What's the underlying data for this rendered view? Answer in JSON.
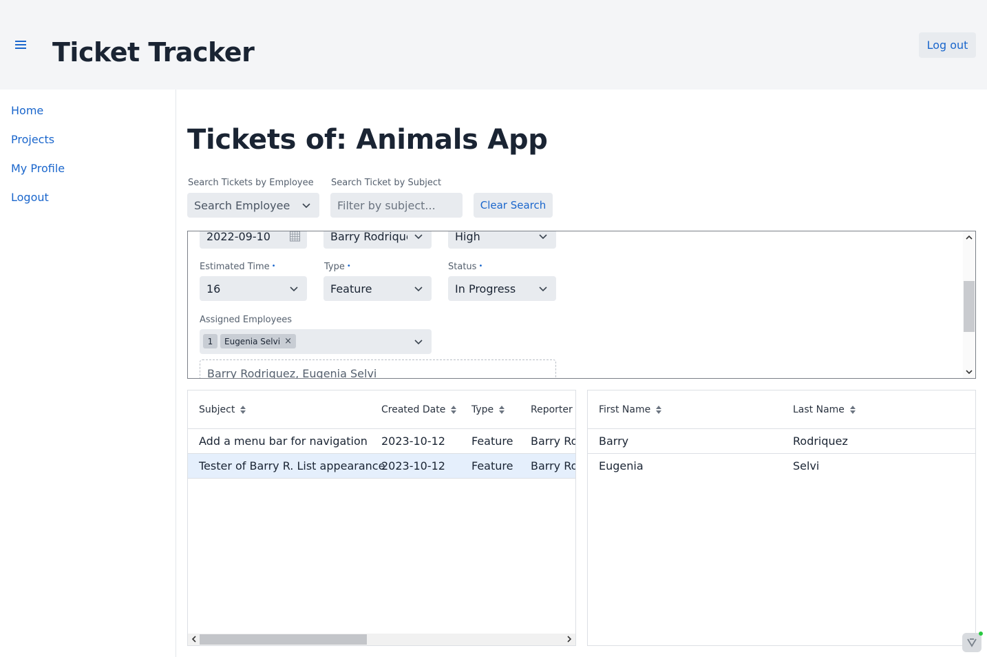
{
  "header": {
    "title": "Ticket Tracker",
    "logout_label": "Log out"
  },
  "sidebar": {
    "items": [
      {
        "label": "Home"
      },
      {
        "label": "Projects"
      },
      {
        "label": "My Profile"
      },
      {
        "label": "Logout"
      }
    ]
  },
  "page": {
    "title": "Tickets of: Animals App"
  },
  "search": {
    "employee_label": "Search Tickets by Employee",
    "employee_placeholder": "Search Employee",
    "subject_label": "Search Ticket by Subject",
    "subject_placeholder": "Filter by subject...",
    "clear_label": "Clear Search"
  },
  "form": {
    "date_value": "2022-09-10",
    "reporter_value": "Barry Rodriquez",
    "priority_value": "High",
    "estimated_time_label": "Estimated Time",
    "estimated_time_value": "16",
    "type_label": "Type",
    "type_value": "Feature",
    "status_label": "Status",
    "status_value": "In Progress",
    "assigned_label": "Assigned Employees",
    "assigned_count": "1",
    "assigned_chip": "Eugenia Selvi",
    "chip_remove": "×",
    "required_marker": "•",
    "assigned_summary": "Barry Rodriquez, Eugenia Selvi"
  },
  "tickets_grid": {
    "columns": [
      "Subject",
      "Created Date",
      "Type",
      "Reporter"
    ],
    "rows": [
      {
        "subject": "Add a menu bar for navigation",
        "created": "2023-10-12",
        "type": "Feature",
        "reporter": "Barry Rodriquez",
        "selected": false
      },
      {
        "subject": "Tester of Barry R. List appearance",
        "created": "2023-10-12",
        "type": "Feature",
        "reporter": "Barry Rodriquez",
        "selected": true
      }
    ]
  },
  "employees_grid": {
    "columns": [
      "First Name",
      "Last Name"
    ],
    "rows": [
      {
        "first": "Barry",
        "last": "Rodriquez"
      },
      {
        "first": "Eugenia",
        "last": "Selvi"
      }
    ]
  },
  "colors": {
    "accent": "#1a66cc",
    "selected_row": "#e5effc",
    "field_bg": "#e8ebef",
    "header_bg": "#f4f5f7"
  },
  "icons": [
    "menu-icon",
    "chevron-down-icon",
    "calendar-icon",
    "sort-icon",
    "close-icon",
    "scroll-up-icon",
    "scroll-down-icon",
    "scroll-left-icon",
    "scroll-right-icon",
    "dev-tools-icon"
  ]
}
